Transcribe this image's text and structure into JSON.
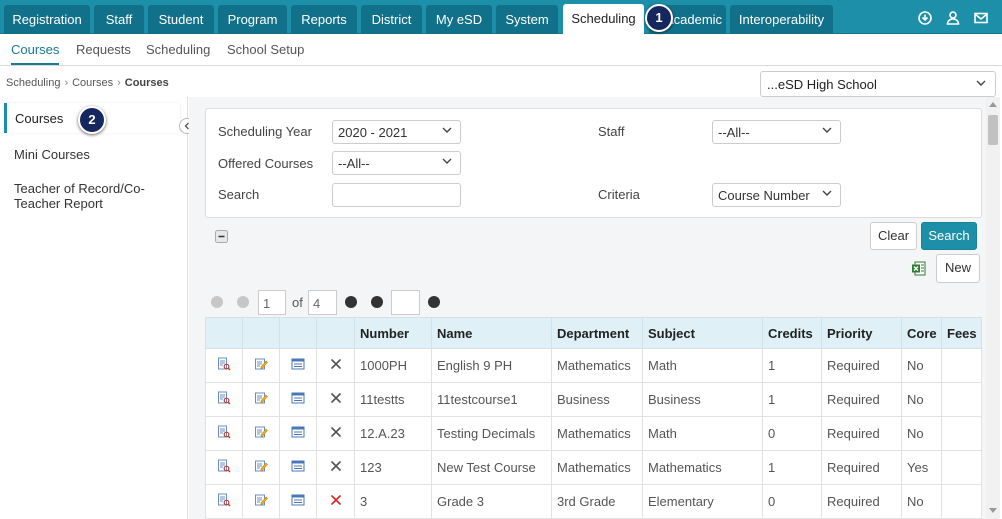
{
  "topnav": {
    "tabs": [
      {
        "label": "Registration"
      },
      {
        "label": "Staff"
      },
      {
        "label": "Student"
      },
      {
        "label": "Program"
      },
      {
        "label": "Reports"
      },
      {
        "label": "District"
      },
      {
        "label": "My eSD"
      },
      {
        "label": "System"
      },
      {
        "label": "Scheduling",
        "active": true
      },
      {
        "label": "Academic"
      },
      {
        "label": "Interoperability"
      }
    ],
    "right_icons": [
      "download-icon",
      "user-settings-icon",
      "mail-icon"
    ]
  },
  "annotations": {
    "badge_1": "1",
    "badge_2": "2"
  },
  "subnav": {
    "items": [
      {
        "label": "Courses",
        "active": true
      },
      {
        "label": "Requests"
      },
      {
        "label": "Scheduling"
      },
      {
        "label": "School Setup"
      }
    ]
  },
  "breadcrumb": {
    "items": [
      "Scheduling",
      "Courses"
    ],
    "current": "Courses"
  },
  "school_select": {
    "value": "...eSD High School"
  },
  "sidebar": {
    "items": [
      {
        "label": "Courses",
        "active": true
      },
      {
        "label": "Mini Courses"
      },
      {
        "label": "Teacher of Record/Co-Teacher Report"
      }
    ]
  },
  "filters": {
    "scheduling_year_label": "Scheduling Year",
    "scheduling_year_value": "2020 - 2021",
    "offered_courses_label": "Offered Courses",
    "offered_courses_value": "--All--",
    "search_label": "Search",
    "search_value": "",
    "staff_label": "Staff",
    "staff_value": "--All--",
    "criteria_label": "Criteria",
    "criteria_value": "Course Number"
  },
  "buttons": {
    "clear": "Clear",
    "search": "Search",
    "new": "New"
  },
  "pager": {
    "page": "1",
    "of_label": "of",
    "total": "4",
    "goto_value": ""
  },
  "table": {
    "columns": [
      "Number",
      "Name",
      "Department",
      "Subject",
      "Credits",
      "Priority",
      "Core",
      "Fees"
    ],
    "rows": [
      {
        "number": "1000PH",
        "name": "English 9 PH",
        "department": "Mathematics",
        "subject": "Math",
        "credits": "1",
        "priority": "Required",
        "core": "No",
        "fees": "",
        "delete_color": "#555555"
      },
      {
        "number": "11testts",
        "name": "11testcourse1",
        "department": "Business",
        "subject": "Business",
        "credits": "1",
        "priority": "Required",
        "core": "No",
        "fees": "",
        "delete_color": "#555555"
      },
      {
        "number": "12.A.23",
        "name": "Testing Decimals",
        "department": "Mathematics",
        "subject": "Math",
        "credits": "0",
        "priority": "Required",
        "core": "No",
        "fees": "",
        "delete_color": "#555555"
      },
      {
        "number": "123",
        "name": "New Test Course",
        "department": "Mathematics",
        "subject": "Mathematics",
        "credits": "1",
        "priority": "Required",
        "core": "Yes",
        "fees": "",
        "delete_color": "#555555"
      },
      {
        "number": "3",
        "name": "Grade 3",
        "department": "3rd Grade",
        "subject": "Elementary",
        "credits": "0",
        "priority": "Required",
        "core": "No",
        "fees": "",
        "delete_color": "#d9262a"
      }
    ]
  },
  "colors": {
    "primary": "#1d8fa8",
    "nav_tab": "#12718a",
    "badge": "#16265e",
    "table_header": "#dff0f6"
  }
}
